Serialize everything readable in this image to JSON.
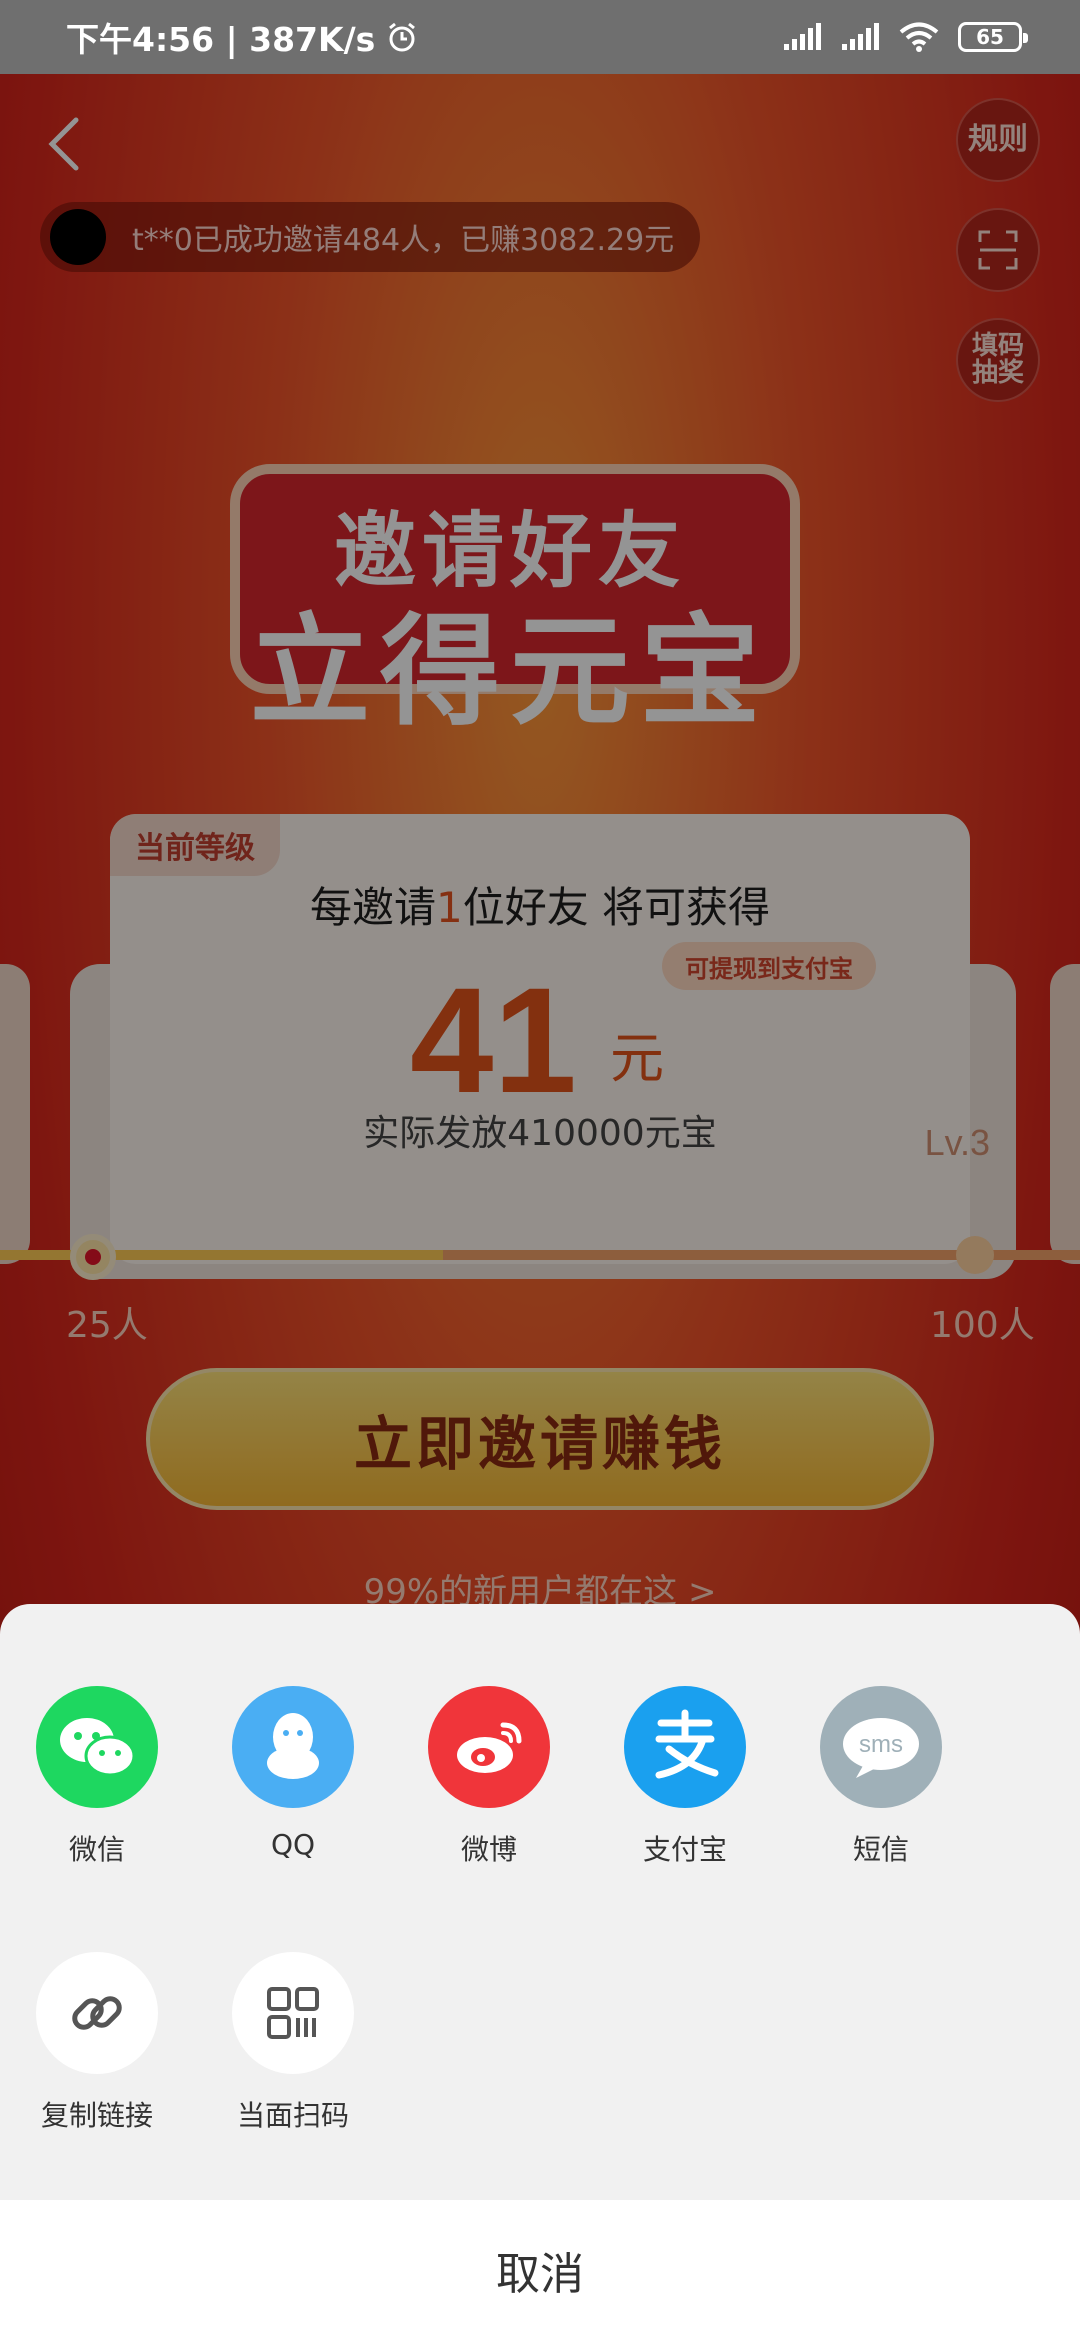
{
  "status_bar": {
    "time_speed": "下午4:56 | 387K/s",
    "battery": "65"
  },
  "promo": {
    "rules_label": "规则",
    "code_label": "填码\n抽奖",
    "ticker_text": "t**0已成功邀请484人，已赚3082.29元",
    "hero_line1": "邀请好友",
    "hero_line2": "立得元宝",
    "level_badge": "当前等级",
    "headline_prefix": "每邀请",
    "headline_num": "1",
    "headline_suffix": "位好友 将可获得",
    "withdraw_pill": "可提现到支付宝",
    "amount": "41",
    "amount_unit": "元",
    "actual_text": "实际发放410000元宝",
    "level": "Lv.3",
    "progress_left_label": "25人",
    "progress_right_label": "100人",
    "progress_fraction": 0.41,
    "cta_label": "立即邀请赚钱",
    "hint": "99%的新用户都在这 >"
  },
  "share_sheet": {
    "items": [
      {
        "label": "微信",
        "icon": "wechat-icon",
        "color": "#1ed760"
      },
      {
        "label": "QQ",
        "icon": "qq-icon",
        "color": "#4aaef3"
      },
      {
        "label": "微博",
        "icon": "weibo-icon",
        "color": "#f0353a"
      },
      {
        "label": "支付宝",
        "icon": "alipay-icon",
        "color": "#1aa0ef"
      },
      {
        "label": "短信",
        "icon": "sms-icon",
        "color": "#9fb0b8"
      },
      {
        "label": "复制链接",
        "icon": "link-icon",
        "color": "#ffffff"
      },
      {
        "label": "当面扫码",
        "icon": "qrcode-icon",
        "color": "#ffffff"
      }
    ],
    "sms_text": "sms",
    "cancel_label": "取消"
  }
}
